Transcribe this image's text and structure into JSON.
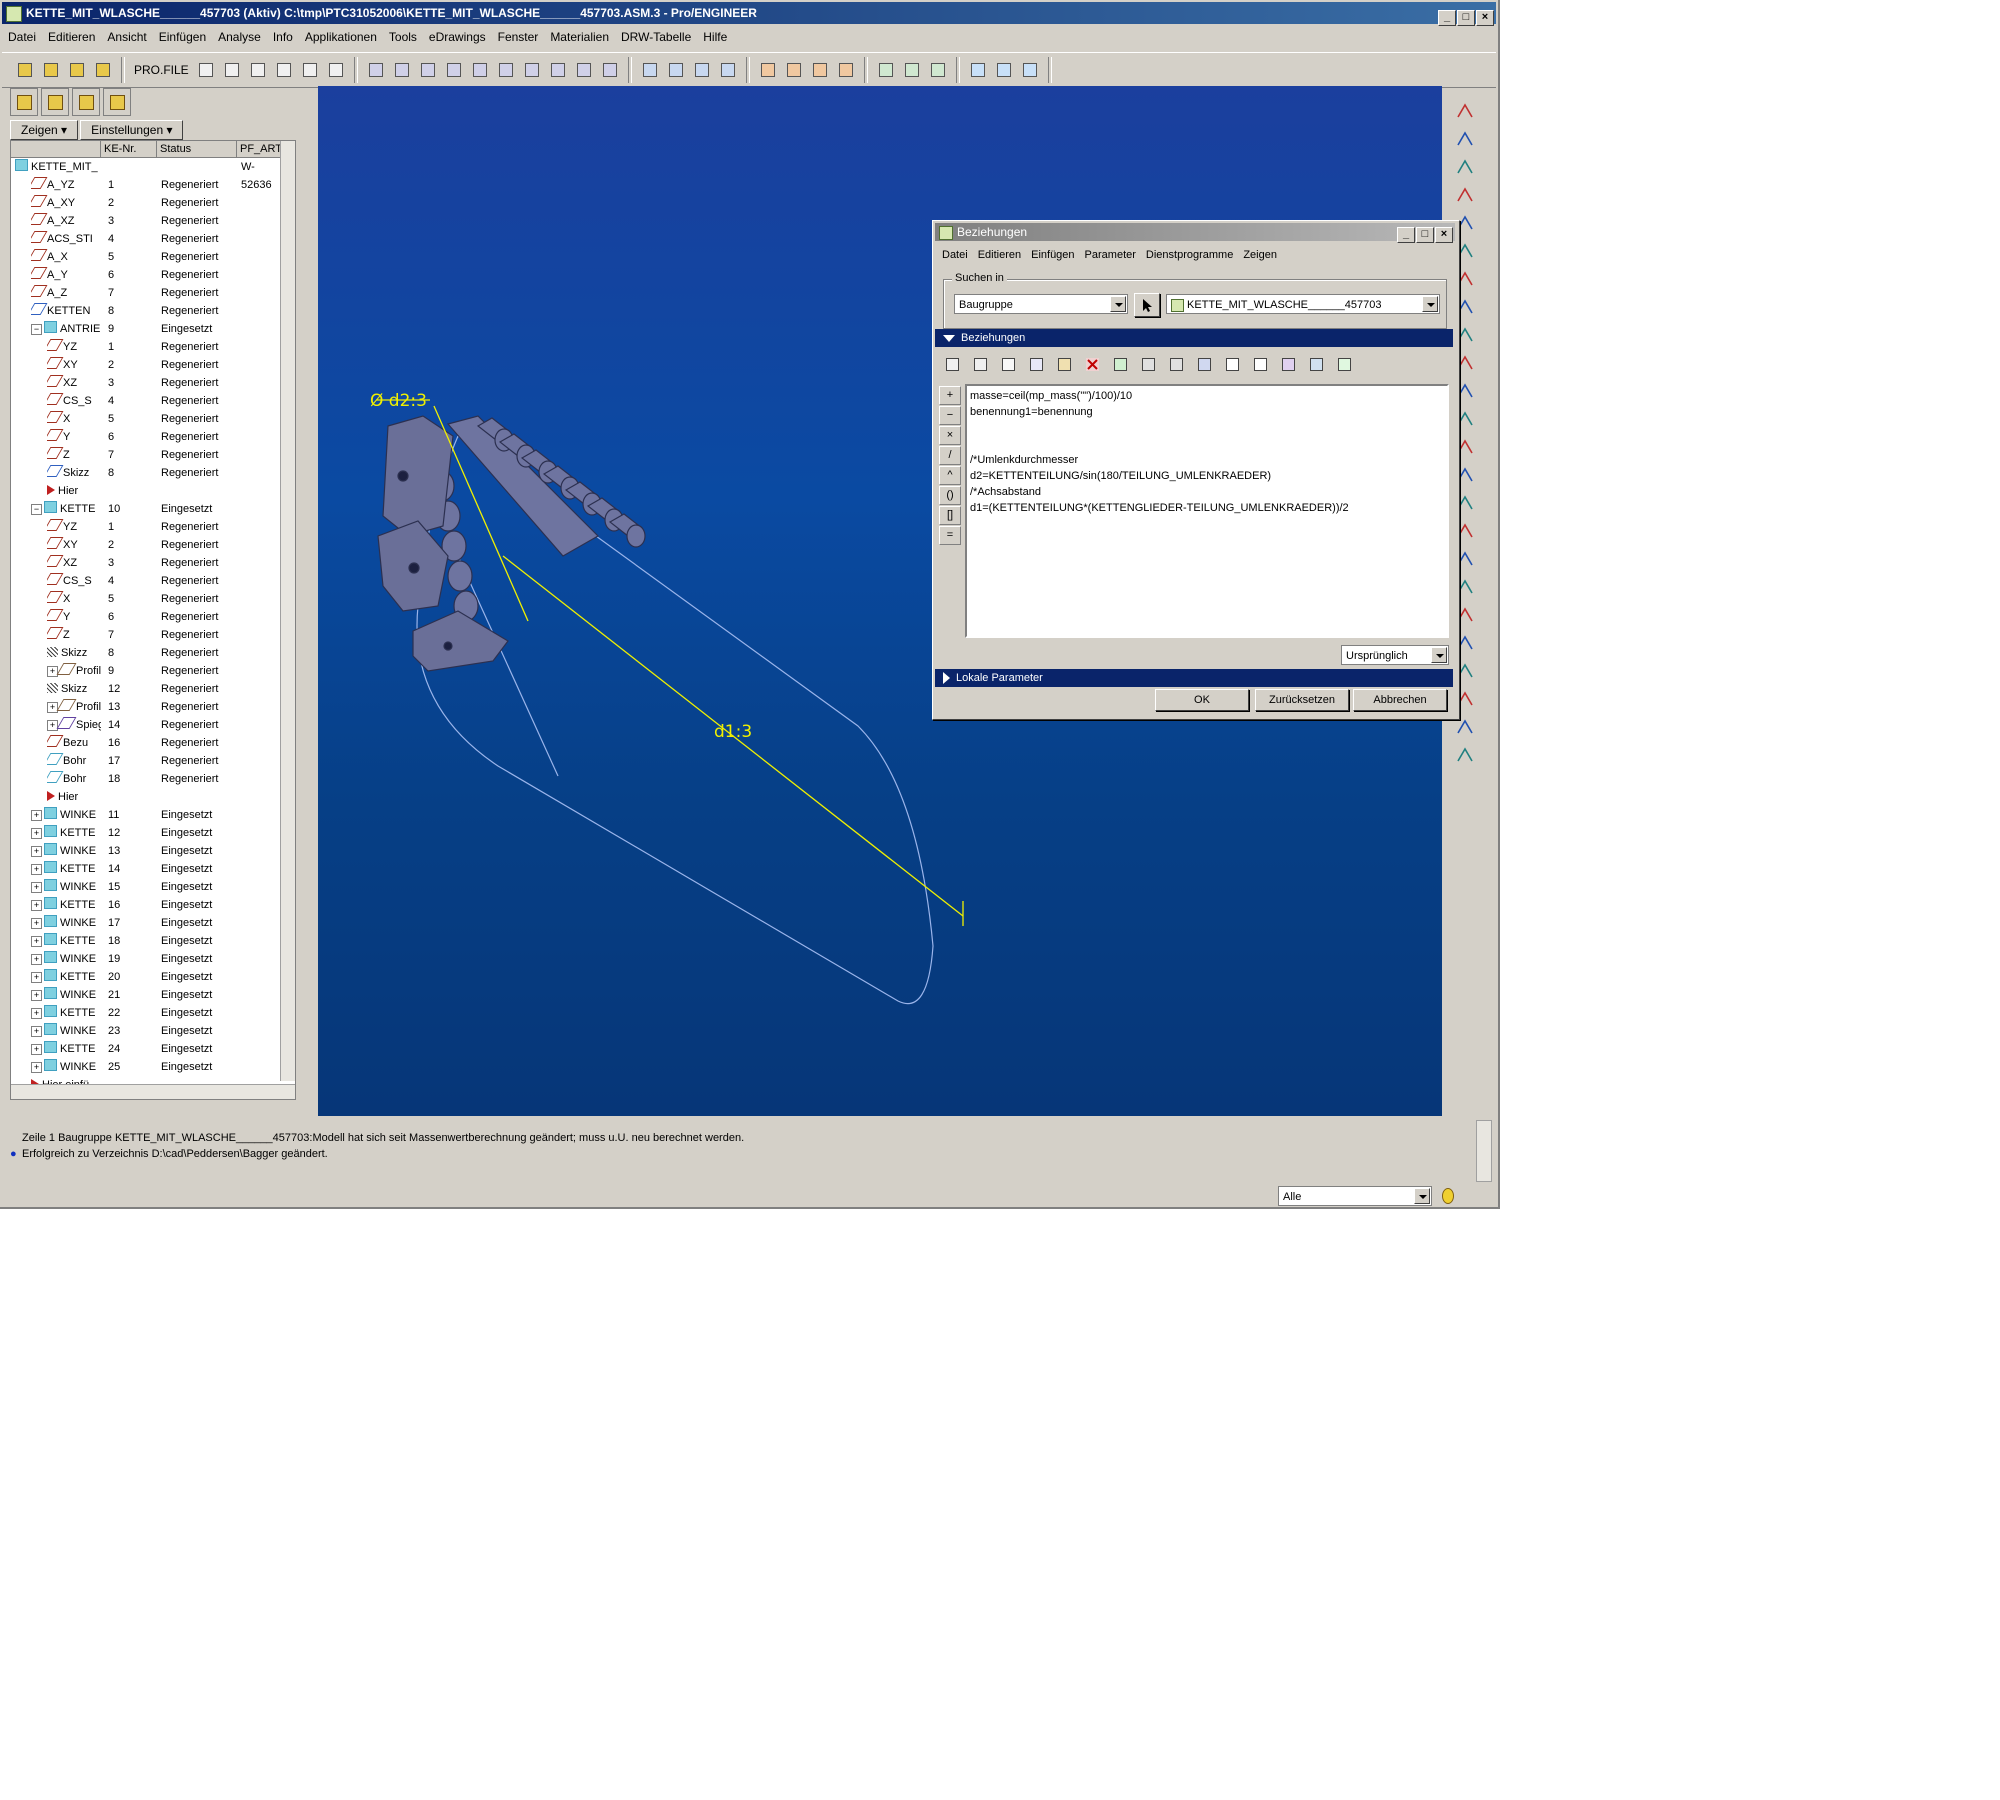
{
  "window": {
    "title": "KETTE_MIT_WLASCHE______457703 (Aktiv) C:\\tmp\\PTC31052006\\KETTE_MIT_WLASCHE______457703.ASM.3 - Pro/ENGINEER"
  },
  "menu": [
    "Datei",
    "Editieren",
    "Ansicht",
    "Einfügen",
    "Analyse",
    "Info",
    "Applikationen",
    "Tools",
    "eDrawings",
    "Fenster",
    "Materialien",
    "DRW-Tabelle",
    "Hilfe"
  ],
  "toolbar": {
    "profile_label": "PRO.FILE"
  },
  "left_panel": {
    "show_button": "Zeigen",
    "settings_button": "Einstellungen",
    "columns": {
      "nr": "KE-Nr.",
      "status": "Status",
      "art": "PF_ARTIKEL"
    },
    "root": {
      "name": "KETTE_MIT_",
      "art": "W-52636"
    },
    "rows": [
      {
        "name": "A_YZ",
        "nr": "1",
        "status": "Regeneriert",
        "lvl": 1,
        "type": "plane"
      },
      {
        "name": "A_XY",
        "nr": "2",
        "status": "Regeneriert",
        "lvl": 1,
        "type": "plane"
      },
      {
        "name": "A_XZ",
        "nr": "3",
        "status": "Regeneriert",
        "lvl": 1,
        "type": "plane"
      },
      {
        "name": "ACS_STI",
        "nr": "4",
        "status": "Regeneriert",
        "lvl": 1,
        "type": "csys"
      },
      {
        "name": "A_X",
        "nr": "5",
        "status": "Regeneriert",
        "lvl": 1,
        "type": "axis"
      },
      {
        "name": "A_Y",
        "nr": "6",
        "status": "Regeneriert",
        "lvl": 1,
        "type": "axis"
      },
      {
        "name": "A_Z",
        "nr": "7",
        "status": "Regeneriert",
        "lvl": 1,
        "type": "axis"
      },
      {
        "name": "KETTEN",
        "nr": "8",
        "status": "Regeneriert",
        "lvl": 1,
        "type": "sketch"
      },
      {
        "name": "ANTRIE",
        "nr": "9",
        "status": "Eingesetzt",
        "lvl": 1,
        "type": "part",
        "exp": "−"
      },
      {
        "name": "YZ",
        "nr": "1",
        "status": "Regeneriert",
        "lvl": 2,
        "type": "plane"
      },
      {
        "name": "XY",
        "nr": "2",
        "status": "Regeneriert",
        "lvl": 2,
        "type": "plane"
      },
      {
        "name": "XZ",
        "nr": "3",
        "status": "Regeneriert",
        "lvl": 2,
        "type": "plane"
      },
      {
        "name": "CS_S",
        "nr": "4",
        "status": "Regeneriert",
        "lvl": 2,
        "type": "csys"
      },
      {
        "name": "X",
        "nr": "5",
        "status": "Regeneriert",
        "lvl": 2,
        "type": "axis"
      },
      {
        "name": "Y",
        "nr": "6",
        "status": "Regeneriert",
        "lvl": 2,
        "type": "axis"
      },
      {
        "name": "Z",
        "nr": "7",
        "status": "Regeneriert",
        "lvl": 2,
        "type": "axis"
      },
      {
        "name": "Skizz",
        "nr": "8",
        "status": "Regeneriert",
        "lvl": 2,
        "type": "sketch"
      },
      {
        "name": "Hier",
        "nr": "",
        "status": "",
        "lvl": 2,
        "type": "insert"
      },
      {
        "name": "KETTE",
        "nr": "10",
        "status": "Eingesetzt",
        "lvl": 1,
        "type": "part",
        "exp": "−"
      },
      {
        "name": "YZ",
        "nr": "1",
        "status": "Regeneriert",
        "lvl": 2,
        "type": "plane"
      },
      {
        "name": "XY",
        "nr": "2",
        "status": "Regeneriert",
        "lvl": 2,
        "type": "plane"
      },
      {
        "name": "XZ",
        "nr": "3",
        "status": "Regeneriert",
        "lvl": 2,
        "type": "plane"
      },
      {
        "name": "CS_S",
        "nr": "4",
        "status": "Regeneriert",
        "lvl": 2,
        "type": "csys"
      },
      {
        "name": "X",
        "nr": "5",
        "status": "Regeneriert",
        "lvl": 2,
        "type": "axis"
      },
      {
        "name": "Y",
        "nr": "6",
        "status": "Regeneriert",
        "lvl": 2,
        "type": "axis"
      },
      {
        "name": "Z",
        "nr": "7",
        "status": "Regeneriert",
        "lvl": 2,
        "type": "axis"
      },
      {
        "name": "Skizz",
        "nr": "8",
        "status": "Regeneriert",
        "lvl": 2,
        "type": "hatch"
      },
      {
        "name": "Profil",
        "nr": "9",
        "status": "Regeneriert",
        "lvl": 2,
        "type": "profile",
        "exp": "+"
      },
      {
        "name": "Skizz",
        "nr": "12",
        "status": "Regeneriert",
        "lvl": 2,
        "type": "hatch"
      },
      {
        "name": "Profil",
        "nr": "13",
        "status": "Regeneriert",
        "lvl": 2,
        "type": "profile",
        "exp": "+"
      },
      {
        "name": "Spieg",
        "nr": "14",
        "status": "Regeneriert",
        "lvl": 2,
        "type": "mirror",
        "exp": "+"
      },
      {
        "name": "Bezu",
        "nr": "16",
        "status": "Regeneriert",
        "lvl": 2,
        "type": "csys"
      },
      {
        "name": "Bohr",
        "nr": "17",
        "status": "Regeneriert",
        "lvl": 2,
        "type": "hole"
      },
      {
        "name": "Bohr",
        "nr": "18",
        "status": "Regeneriert",
        "lvl": 2,
        "type": "hole"
      },
      {
        "name": "Hier",
        "nr": "",
        "status": "",
        "lvl": 2,
        "type": "insert"
      },
      {
        "name": "WINKE",
        "nr": "11",
        "status": "Eingesetzt",
        "lvl": 1,
        "type": "part",
        "exp": "+"
      },
      {
        "name": "KETTE",
        "nr": "12",
        "status": "Eingesetzt",
        "lvl": 1,
        "type": "part",
        "exp": "+"
      },
      {
        "name": "WINKE",
        "nr": "13",
        "status": "Eingesetzt",
        "lvl": 1,
        "type": "part",
        "exp": "+"
      },
      {
        "name": "KETTE",
        "nr": "14",
        "status": "Eingesetzt",
        "lvl": 1,
        "type": "part",
        "exp": "+"
      },
      {
        "name": "WINKE",
        "nr": "15",
        "status": "Eingesetzt",
        "lvl": 1,
        "type": "part",
        "exp": "+"
      },
      {
        "name": "KETTE",
        "nr": "16",
        "status": "Eingesetzt",
        "lvl": 1,
        "type": "part",
        "exp": "+"
      },
      {
        "name": "WINKE",
        "nr": "17",
        "status": "Eingesetzt",
        "lvl": 1,
        "type": "part",
        "exp": "+"
      },
      {
        "name": "KETTE",
        "nr": "18",
        "status": "Eingesetzt",
        "lvl": 1,
        "type": "part",
        "exp": "+"
      },
      {
        "name": "WINKE",
        "nr": "19",
        "status": "Eingesetzt",
        "lvl": 1,
        "type": "part",
        "exp": "+"
      },
      {
        "name": "KETTE",
        "nr": "20",
        "status": "Eingesetzt",
        "lvl": 1,
        "type": "part",
        "exp": "+"
      },
      {
        "name": "WINKE",
        "nr": "21",
        "status": "Eingesetzt",
        "lvl": 1,
        "type": "part",
        "exp": "+"
      },
      {
        "name": "KETTE",
        "nr": "22",
        "status": "Eingesetzt",
        "lvl": 1,
        "type": "part",
        "exp": "+"
      },
      {
        "name": "WINKE",
        "nr": "23",
        "status": "Eingesetzt",
        "lvl": 1,
        "type": "part",
        "exp": "+"
      },
      {
        "name": "KETTE",
        "nr": "24",
        "status": "Eingesetzt",
        "lvl": 1,
        "type": "part",
        "exp": "+"
      },
      {
        "name": "WINKE",
        "nr": "25",
        "status": "Eingesetzt",
        "lvl": 1,
        "type": "part",
        "exp": "+"
      },
      {
        "name": "Hier einfü",
        "nr": "",
        "status": "",
        "lvl": 1,
        "type": "insert"
      }
    ]
  },
  "viewport": {
    "dim_d2": "Ø d2:3",
    "dim_d1": "d1:3"
  },
  "dialog": {
    "title": "Beziehungen",
    "menu": [
      "Datei",
      "Editieren",
      "Einfügen",
      "Parameter",
      "Dienstprogramme",
      "Zeigen"
    ],
    "search_in_label": "Suchen in",
    "scope_value": "Baugruppe",
    "model_value": "KETTE_MIT_WLASCHE______457703",
    "section_relations": "Beziehungen",
    "section_local": "Lokale Parameter",
    "side_ops": [
      "+",
      "−",
      "×",
      "/",
      "^",
      "()",
      "[]",
      "="
    ],
    "editor_lines": [
      "masse=ceil(mp_mass(\"\")/100)/10",
      "benennung1=benennung",
      "",
      "",
      "/*Umlenkdurchmesser",
      "d2=KETTENTEILUNG/sin(180/TEILUNG_UMLENKRAEDER)",
      "/*Achsabstand",
      "d1=(KETTENTEILUNG*(KETTENGLIEDER-TEILUNG_UMLENKRAEDER))/2"
    ],
    "units_value": "Ursprünglich",
    "ok": "OK",
    "reset": "Zurücksetzen",
    "cancel": "Abbrechen"
  },
  "messages": [
    "Zeile 1 Baugruppe KETTE_MIT_WLASCHE______457703:Modell hat sich seit Massenwertberechnung geändert; muss u.U. neu berechnet werden.",
    "Erfolgreich zu Verzeichnis D:\\cad\\Peddersen\\Bagger geändert."
  ],
  "status": {
    "filter_value": "Alle"
  },
  "colors": {
    "viewport_top": "#1b3f9e",
    "viewport_bottom": "#063678",
    "dimension": "#f0f000",
    "part": "#6e74a0"
  }
}
